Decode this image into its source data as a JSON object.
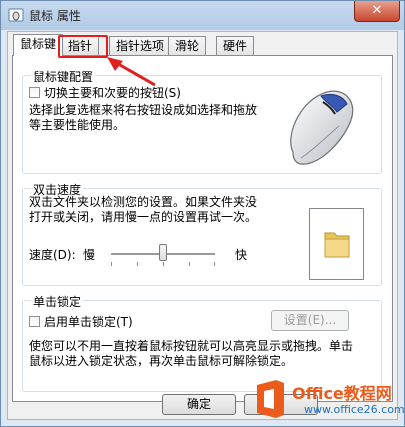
{
  "window": {
    "title": "鼠标 属性",
    "close_symbol": "✕"
  },
  "tabs": [
    {
      "label": "鼠标键",
      "active": true
    },
    {
      "label": "指针",
      "active": false
    },
    {
      "label": "指针选项",
      "active": false
    },
    {
      "label": "滑轮",
      "active": false
    },
    {
      "label": "硬件",
      "active": false
    }
  ],
  "button_config": {
    "group_title": "鼠标键配置",
    "checkbox_label": "切换主要和次要的按钮(S)",
    "description_line1": "选择此复选框来将右按钮设成如选择和拖放",
    "description_line2": "等主要性能使用。"
  },
  "double_click": {
    "group_title": "双击速度",
    "description_line1": "双击文件夹以检测您的设置。如果文件夹没",
    "description_line2": "打开或关闭，请用慢一点的设置再试一次。",
    "speed_label": "速度(D):",
    "slow_label": "慢",
    "fast_label": "快",
    "speed_level": 0.5
  },
  "click_lock": {
    "group_title": "单击锁定",
    "checkbox_label": "启用单击锁定(T)",
    "settings_button": "设置(E)...",
    "description_line1": "使您可以不用一直按着鼠标按钮就可以高亮显示或拖拽。单击",
    "description_line2": "鼠标以进入锁定状态，再次单击鼠标可解除锁定。"
  },
  "footer": {
    "ok_label": "确定"
  },
  "watermark": {
    "brand": "Office教程网",
    "url": "www.office26.com",
    "colors": {
      "orange": "#ea5b1c",
      "blue": "#1a6fc4"
    }
  }
}
